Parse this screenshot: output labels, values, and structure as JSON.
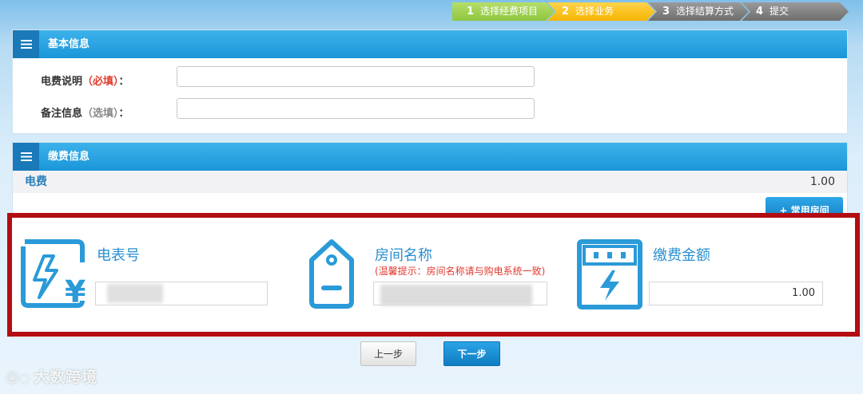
{
  "stepper": {
    "steps": [
      {
        "num": "1",
        "label": "选择经费项目"
      },
      {
        "num": "2",
        "label": "选择业务"
      },
      {
        "num": "3",
        "label": "选择结算方式"
      },
      {
        "num": "4",
        "label": "提交"
      }
    ],
    "active_index": 1
  },
  "basic_info": {
    "title": "基本信息",
    "fields": [
      {
        "label": "电费说明",
        "tag": "（必填）",
        "colon": "：",
        "value": ""
      },
      {
        "label": "备注信息",
        "tag": "（选填）",
        "colon": "：",
        "value": ""
      }
    ]
  },
  "payment_info": {
    "title": "缴费信息",
    "fee_name": "电费",
    "fee_amount": "1.00",
    "common_room_button": "+ 常用房间"
  },
  "cards": {
    "meter": {
      "label": "电表号",
      "icon": "electric-meter-yuan-icon"
    },
    "room": {
      "label": "房间名称",
      "hint": "(温馨提示：房间名称请与购电系统一致)",
      "icon": "room-tag-icon"
    },
    "amount": {
      "label": "缴费金额",
      "value": "1.00",
      "icon": "power-box-icon"
    }
  },
  "nav": {
    "prev_label": "上一步",
    "next_label": "下一步"
  },
  "watermark": {
    "text": "大数跨境"
  },
  "colors": {
    "accent": "#1a96d8",
    "highlight_border": "#b30d12",
    "required": "#e03b2d",
    "step_done": "#8ec63f",
    "step_active": "#f6b400",
    "step_todo": "#6e6e6e"
  }
}
